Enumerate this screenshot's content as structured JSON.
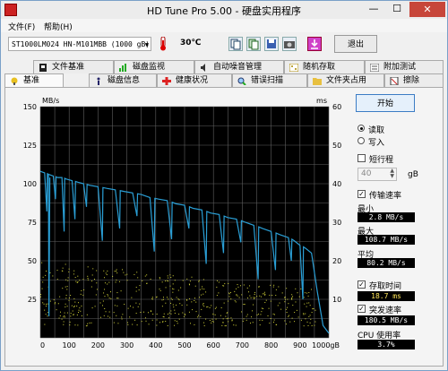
{
  "window": {
    "title": "HD Tune Pro 5.00 - 硬盘实用程序",
    "min": "—",
    "max": "☐",
    "close": "✕"
  },
  "menu": {
    "file": "文件(F)",
    "help": "帮助(H)"
  },
  "toolbar": {
    "drive": "ST1000LM024 HN-M101MBB (1000 gB)",
    "temperature": "30℃",
    "exit_label": "退出"
  },
  "tabs_top": [
    "文件基准",
    "磁盘监视",
    "自动噪音管理",
    "随机存取",
    "附加测试"
  ],
  "tabs_bottom": [
    "基准",
    "磁盘信息",
    "健康状况",
    "错误扫描",
    "文件夹占用",
    "擦除"
  ],
  "controls": {
    "start_label": "开始",
    "read_label": "读取",
    "write_label": "写入",
    "short_stroke_label": "短行程",
    "short_stroke_value": "40",
    "short_stroke_unit": "gB",
    "transfer_rate_label": "传输速率",
    "min_label": "最小",
    "min_value": "2.8 MB/s",
    "max_label": "最大",
    "max_value": "108.7 MB/s",
    "avg_label": "平均",
    "avg_value": "80.2 MB/s",
    "access_time_label": "存取时间",
    "access_time_value": "18.7 ms",
    "burst_rate_label": "突发速率",
    "burst_rate_value": "180.5 MB/s",
    "cpu_label": "CPU 使用率",
    "cpu_value": "3.7%"
  },
  "chart_data": {
    "type": "line",
    "left_unit": "MB/s",
    "right_unit": "ms",
    "y_left_ticks": [
      25,
      50,
      75,
      100,
      125,
      150
    ],
    "y_right_ticks": [
      10,
      20,
      30,
      40,
      50,
      60
    ],
    "ylim_left": [
      0,
      150
    ],
    "ylim_right": [
      0,
      60
    ],
    "x_ticks": [
      "0",
      "100",
      "200",
      "300",
      "400",
      "500",
      "600",
      "700",
      "800",
      "900",
      "1000gB"
    ],
    "xlim": [
      0,
      1000
    ],
    "grid": true,
    "colors": {
      "background": "#000000",
      "grid": "#606060",
      "transfer": "#2a9fd6",
      "access": "#d4d43a"
    },
    "series": [
      {
        "x": [
          0,
          15,
          30,
          45,
          60,
          75,
          90,
          110,
          130,
          150,
          170,
          200,
          230,
          260,
          290,
          320,
          350,
          380,
          410,
          440,
          470,
          500,
          530,
          560,
          590,
          620,
          650,
          680,
          710,
          740,
          770,
          800,
          830,
          860,
          880,
          900,
          920,
          940,
          960,
          980,
          1000
        ],
        "y": [
          108,
          107,
          106,
          105,
          104,
          104,
          103,
          102,
          101,
          100,
          99,
          98,
          97,
          96,
          95,
          94,
          93,
          91,
          90,
          89,
          87,
          86,
          84,
          83,
          81,
          80,
          78,
          77,
          75,
          73,
          71,
          69,
          67,
          65,
          63,
          60,
          58,
          55,
          30,
          8,
          3
        ]
      }
    ]
  }
}
